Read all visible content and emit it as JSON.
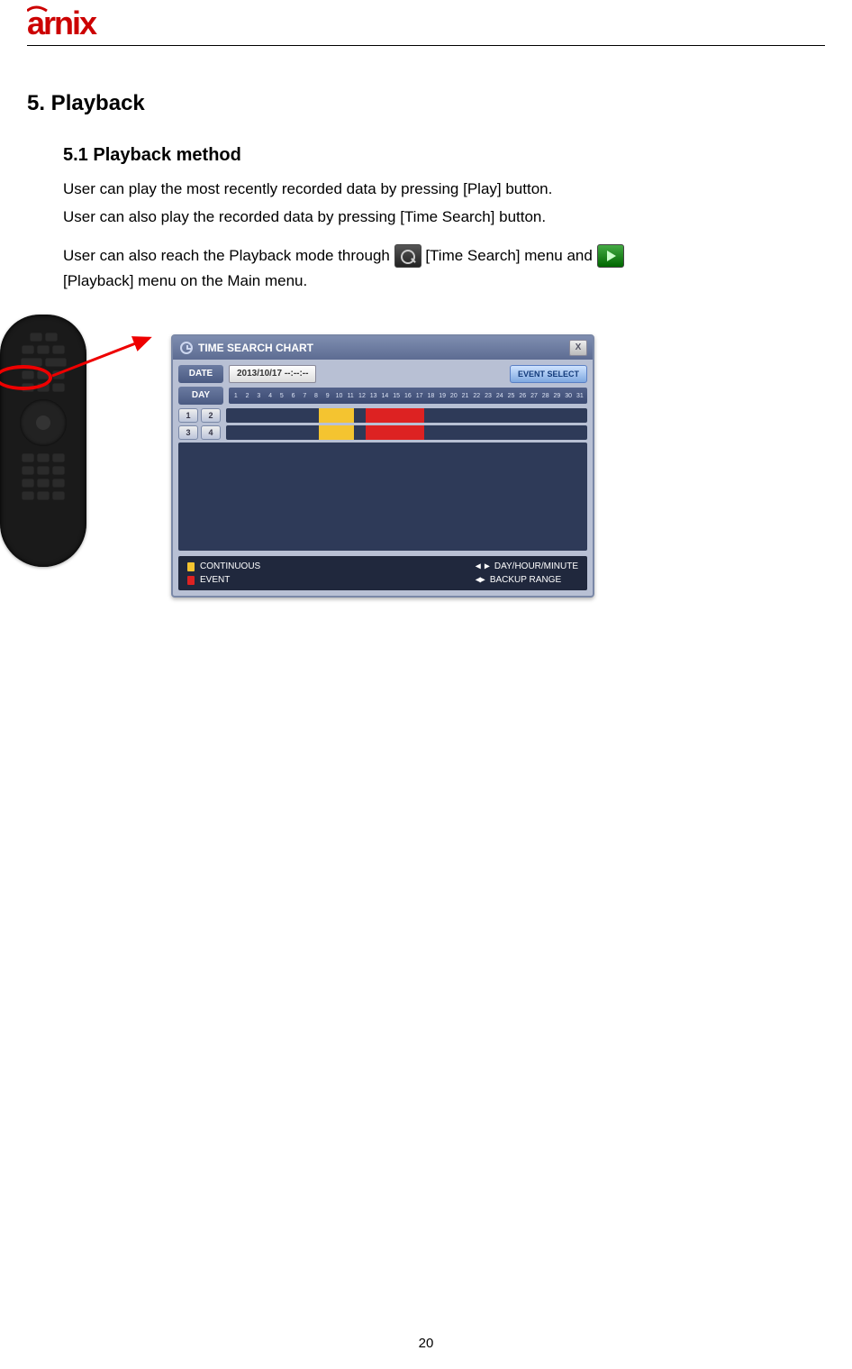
{
  "logo_text": "arnix",
  "section_heading": "5. Playback",
  "subsection_heading": "5.1  Playback  method",
  "para1": "User can play the most recently recorded data by pressing [Play] button.",
  "para2": "User can also play the recorded data by pressing [Time Search] button.",
  "para3a": "User  can  also  reach  the  Playback  mode  through ",
  "para3b": " [Time  Search]  menu  and ",
  "para3c": "[Playback] menu on the Main menu.",
  "chart": {
    "title": "TIME SEARCH CHART",
    "close": "X",
    "date_label": "DATE",
    "date_value": "2013/10/17 --:--:--",
    "event_select": "EVENT SELECT",
    "day_label": "DAY",
    "days": [
      "1",
      "2",
      "3",
      "4",
      "5",
      "6",
      "7",
      "8",
      "9",
      "10",
      "11",
      "12",
      "13",
      "14",
      "15",
      "16",
      "17",
      "18",
      "19",
      "20",
      "21",
      "22",
      "23",
      "24",
      "25",
      "26",
      "27",
      "28",
      "29",
      "30",
      "31"
    ],
    "channels": [
      "1",
      "2",
      "3",
      "4"
    ],
    "legend_continuous": "CONTINUOUS",
    "legend_event": "EVENT",
    "legend_dayhour": "DAY/HOUR/MINUTE",
    "legend_backup": "BACKUP RANGE",
    "legend_dayhour_sym": "◀ ▶",
    "legend_backup_sym": "◀▶"
  },
  "chart_data": {
    "type": "table",
    "title": "TIME SEARCH CHART",
    "date": "2013/10/17",
    "day_axis": [
      1,
      2,
      3,
      4,
      5,
      6,
      7,
      8,
      9,
      10,
      11,
      12,
      13,
      14,
      15,
      16,
      17,
      18,
      19,
      20,
      21,
      22,
      23,
      24,
      25,
      26,
      27,
      28,
      29,
      30,
      31
    ],
    "channels": [
      {
        "id": 1,
        "segments": [
          {
            "start": 9,
            "end": 11,
            "type": "continuous"
          },
          {
            "start": 13,
            "end": 17,
            "type": "event"
          }
        ]
      },
      {
        "id": 2,
        "segments": [
          {
            "start": 9,
            "end": 11,
            "type": "continuous"
          },
          {
            "start": 13,
            "end": 17,
            "type": "event"
          }
        ]
      },
      {
        "id": 3,
        "segments": [
          {
            "start": 9,
            "end": 11,
            "type": "continuous"
          },
          {
            "start": 13,
            "end": 17,
            "type": "event"
          }
        ]
      },
      {
        "id": 4,
        "segments": [
          {
            "start": 9,
            "end": 11,
            "type": "continuous"
          },
          {
            "start": 13,
            "end": 17,
            "type": "event"
          }
        ]
      }
    ],
    "legend": {
      "continuous": "yellow",
      "event": "red"
    }
  },
  "page_number": "20"
}
